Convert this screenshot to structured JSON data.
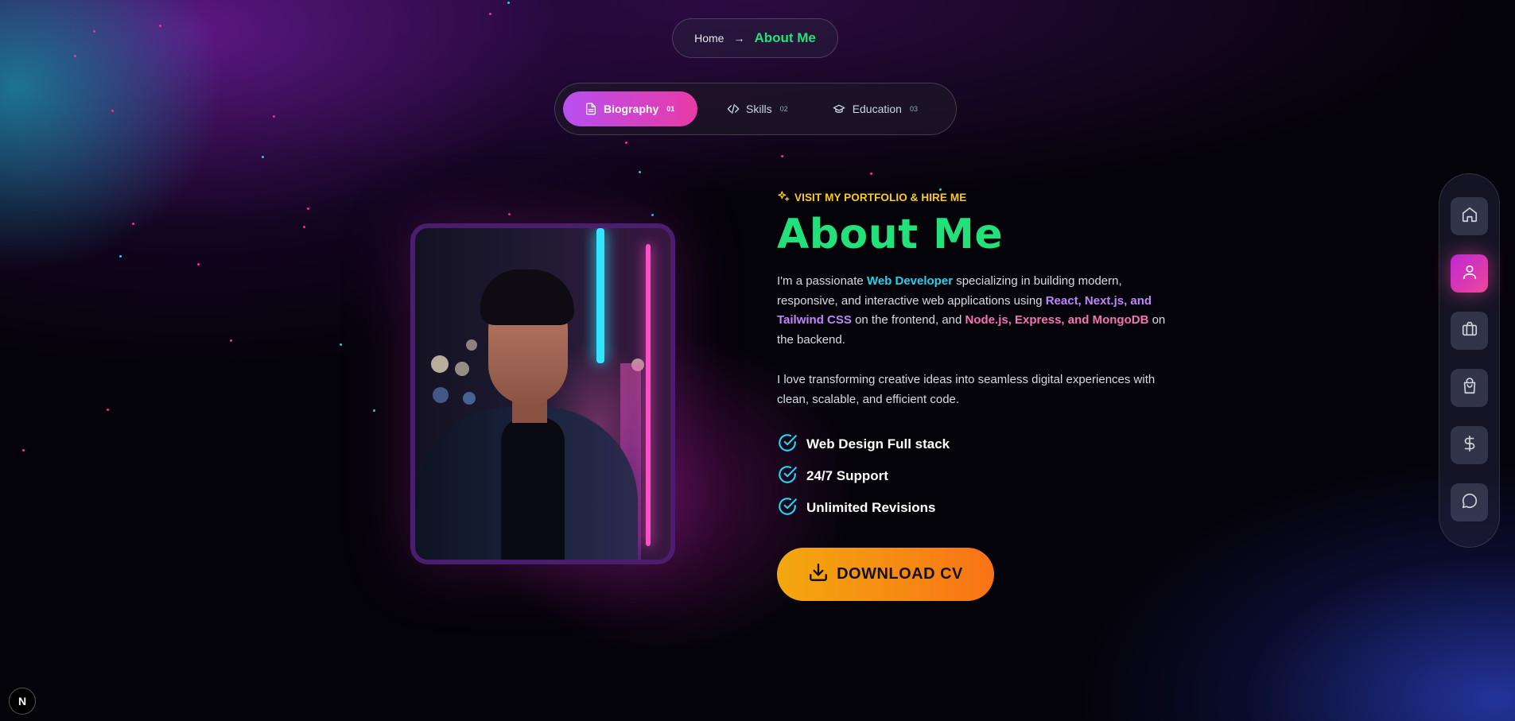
{
  "breadcrumb": {
    "home": "Home",
    "arrow": "→",
    "current": "About Me"
  },
  "tabs": [
    {
      "label": "Biography",
      "number": "01",
      "icon": "document-icon",
      "active": true
    },
    {
      "label": "Skills",
      "number": "02",
      "icon": "code-icon",
      "active": false
    },
    {
      "label": "Education",
      "number": "03",
      "icon": "graduation-cap-icon",
      "active": false
    }
  ],
  "about": {
    "eyebrow": "VISIT MY PORTFOLIO & HIRE ME",
    "title": "About Me",
    "para1": {
      "t1": "I'm a passionate ",
      "h1": "Web Developer",
      "t2": " specializing in building modern, responsive, and interactive web applications using ",
      "h2": "React, Next.js, and Tailwind CSS",
      "t3": " on the frontend, and ",
      "h3": "Node.js, Express, and MongoDB",
      "t4": " on the backend."
    },
    "para2": "I love transforming creative ideas into seamless digital experiences with clean, scalable, and efficient code.",
    "features": [
      "Web Design Full stack",
      "24/7 Support",
      "Unlimited Revisions"
    ],
    "cv_button": "DOWNLOAD CV"
  },
  "sidenav": [
    {
      "name": "home",
      "icon": "home-icon",
      "active": false
    },
    {
      "name": "about",
      "icon": "user-icon",
      "active": true
    },
    {
      "name": "portfolio",
      "icon": "briefcase-icon",
      "active": false
    },
    {
      "name": "shop",
      "icon": "shopping-bag-icon",
      "active": false
    },
    {
      "name": "pricing",
      "icon": "dollar-icon",
      "active": false
    },
    {
      "name": "contact",
      "icon": "chat-icon",
      "active": false
    }
  ],
  "badge": "N",
  "colors": {
    "accent_green": "#22e07a",
    "accent_yellow": "#facc15",
    "tab_active_gradient": [
      "#b84ff0",
      "#e93aa6"
    ],
    "button_gradient": [
      "#f3a80f",
      "#f97316"
    ],
    "highlight_cyan": "#22d3ee",
    "highlight_violet": "#c084fc",
    "highlight_pink": "#f472b6"
  }
}
